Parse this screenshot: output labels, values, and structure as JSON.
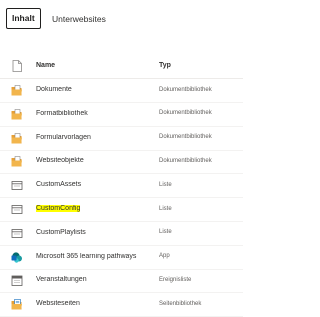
{
  "tabs": {
    "active_label": "Inhalt",
    "other_label": "Unterwebsites"
  },
  "columns": {
    "name": "Name",
    "type": "Typ"
  },
  "rows": [
    {
      "name": "Dokumente",
      "type": "Dokumentbibliothek",
      "icon": "document-library-icon"
    },
    {
      "name": "Formatbibliothek",
      "type": "Dokumentbibliothek",
      "icon": "document-library-icon"
    },
    {
      "name": "Formularvorlagen",
      "type": "Dokumentbibliothek",
      "icon": "document-library-icon"
    },
    {
      "name": "Websiteobjekte",
      "type": "Dokumentbibliothek",
      "icon": "document-library-icon"
    },
    {
      "name": "CustomAssets",
      "type": "Liste",
      "icon": "list-icon"
    },
    {
      "name": "CustomConfig",
      "type": "Liste",
      "icon": "list-icon",
      "highlighted": true,
      "highlight_color": "#ffff00"
    },
    {
      "name": "CustomPlaylists",
      "type": "Liste",
      "icon": "list-icon"
    },
    {
      "name": "Microsoft 365 learning pathways",
      "type": "App",
      "icon": "sharepoint-app-icon"
    },
    {
      "name": "Veranstaltungen",
      "type": "Ereignisliste",
      "icon": "calendar-icon"
    },
    {
      "name": "Websiteseiten",
      "type": "Seitenbibliothek",
      "icon": "page-library-icon"
    }
  ],
  "colors": {
    "folder_orange": "#e8a035",
    "sharepoint_blue": "#0f6cbd",
    "text": "#323130",
    "muted": "#605e5c"
  }
}
